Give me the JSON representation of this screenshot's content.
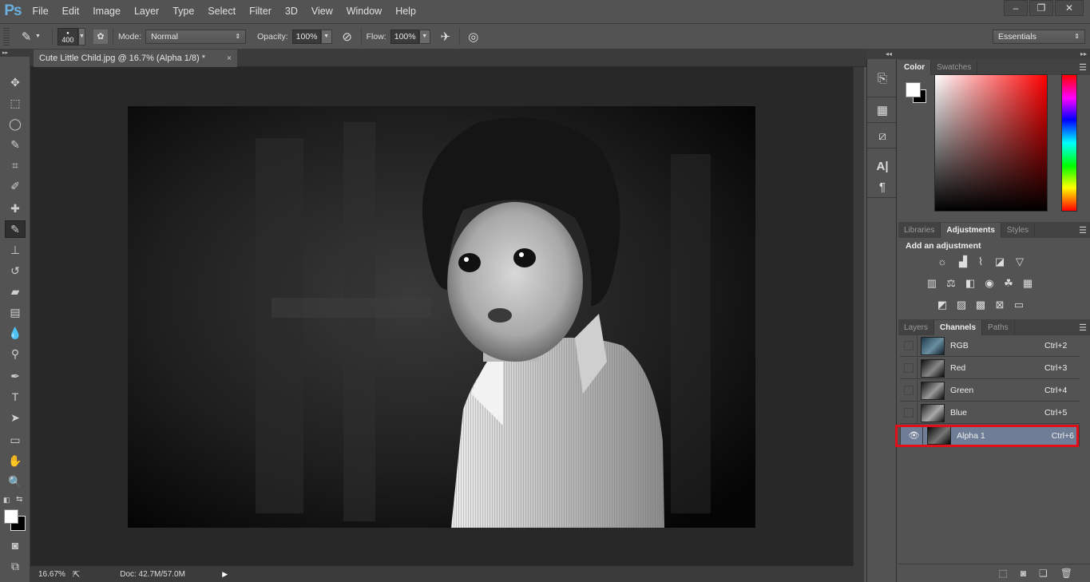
{
  "app": {
    "logo": "Ps"
  },
  "menu": [
    "File",
    "Edit",
    "Image",
    "Layer",
    "Type",
    "Select",
    "Filter",
    "3D",
    "View",
    "Window",
    "Help"
  ],
  "window_controls": {
    "minimize": "–",
    "restore": "❐",
    "close": "✕"
  },
  "options": {
    "brush_size": "400",
    "mode_label": "Mode:",
    "mode_value": "Normal",
    "opacity_label": "Opacity:",
    "opacity_value": "100%",
    "flow_label": "Flow:",
    "flow_value": "100%",
    "workspace": "Essentials"
  },
  "document": {
    "tab_title": "Cute Little Child.jpg @ 16.7% (Alpha 1/8) *",
    "close": "×"
  },
  "tools": [
    {
      "name": "move-tool",
      "glyph": "✥"
    },
    {
      "name": "marquee-tool",
      "glyph": "⬚"
    },
    {
      "name": "lasso-tool",
      "glyph": "◯"
    },
    {
      "name": "quick-selection-tool",
      "glyph": "✎"
    },
    {
      "name": "crop-tool",
      "glyph": "⌗"
    },
    {
      "name": "eyedropper-tool",
      "glyph": "✐"
    },
    {
      "name": "healing-brush-tool",
      "glyph": "✚"
    },
    {
      "name": "brush-tool",
      "glyph": "✎",
      "active": true
    },
    {
      "name": "clone-stamp-tool",
      "glyph": "⊥"
    },
    {
      "name": "history-brush-tool",
      "glyph": "↺"
    },
    {
      "name": "eraser-tool",
      "glyph": "▰"
    },
    {
      "name": "gradient-tool",
      "glyph": "▤"
    },
    {
      "name": "blur-tool",
      "glyph": "💧"
    },
    {
      "name": "dodge-tool",
      "glyph": "⚲"
    },
    {
      "name": "pen-tool",
      "glyph": "✒"
    },
    {
      "name": "type-tool",
      "glyph": "T"
    },
    {
      "name": "path-selection-tool",
      "glyph": "➤"
    },
    {
      "name": "rectangle-tool",
      "glyph": "▭"
    },
    {
      "name": "hand-tool",
      "glyph": "✋"
    },
    {
      "name": "zoom-tool",
      "glyph": "🔍"
    }
  ],
  "status": {
    "zoom": "16.67%",
    "doc": "Doc: 42.7M/57.0M",
    "arrow": "▶"
  },
  "color_panel": {
    "tabs": [
      "Color",
      "Swatches"
    ],
    "active_tab": "Color",
    "foreground": "#ffffff",
    "background": "#000000"
  },
  "adjustments_panel": {
    "tabs": [
      "Libraries",
      "Adjustments",
      "Styles"
    ],
    "active_tab": "Adjustments",
    "heading": "Add an adjustment",
    "rows": [
      [
        "brightness-contrast",
        "levels",
        "curves",
        "exposure",
        "vibrance"
      ],
      [
        "hue-saturation",
        "color-balance",
        "black-white",
        "photo-filter",
        "channel-mixer",
        "color-lookup"
      ],
      [
        "invert",
        "posterize",
        "threshold",
        "selective-color",
        "gradient-map"
      ]
    ]
  },
  "channels_panel": {
    "tabs": [
      "Layers",
      "Channels",
      "Paths"
    ],
    "active_tab": "Channels",
    "channels": [
      {
        "name": "RGB",
        "shortcut": "Ctrl+2",
        "visible": false,
        "selected": false
      },
      {
        "name": "Red",
        "shortcut": "Ctrl+3",
        "visible": false,
        "selected": false
      },
      {
        "name": "Green",
        "shortcut": "Ctrl+4",
        "visible": false,
        "selected": false
      },
      {
        "name": "Blue",
        "shortcut": "Ctrl+5",
        "visible": false,
        "selected": false
      },
      {
        "name": "Alpha 1",
        "shortcut": "Ctrl+6",
        "visible": true,
        "selected": true
      }
    ],
    "highlight_color": "#e0101a",
    "footer_icons": [
      "load-selection",
      "save-selection",
      "new-channel",
      "delete-channel"
    ]
  }
}
